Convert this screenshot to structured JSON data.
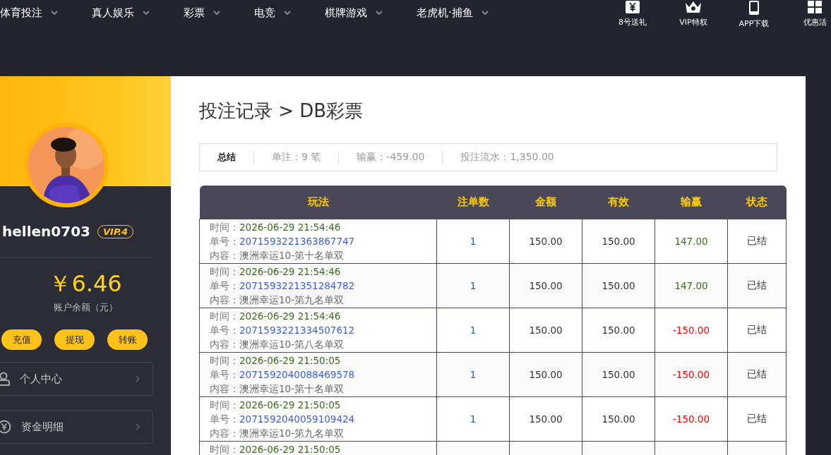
{
  "nav": {
    "items": [
      "体育投注",
      "真人娱乐",
      "彩票",
      "电竞",
      "棋牌游戏",
      "老虎机·捕鱼"
    ],
    "quick_links": [
      "8号送礼",
      "VIP特权",
      "APP下载",
      "优惠活"
    ]
  },
  "profile": {
    "avatar": {
      "kind": "picture"
    },
    "username": "hellen0703",
    "vip_badge": "VIP.4",
    "balance": "￥6.46",
    "balance_label": "账户余额（元）",
    "actions": [
      "充值",
      "提现",
      "转账"
    ],
    "menu": [
      {
        "label": "个人中心"
      },
      {
        "label": "资金明细"
      }
    ]
  },
  "page_title": "投注记录 > DB彩票",
  "summary": {
    "title": "总结",
    "items": [
      "单注：9 笔",
      "输赢：-459.00",
      "投注流水：1,350.00"
    ]
  },
  "table": {
    "columns": [
      "玩法",
      "注单数",
      "金额",
      "有效",
      "输赢",
      "状态"
    ],
    "rows": [
      {
        "time_label": "时间：",
        "time": "2026-06-29 21:54:46",
        "order_label": "单号：",
        "order": "2071593221363867747",
        "content_label": "内容：",
        "content": "澳洲幸运10-第十名单双",
        "count": "1",
        "amount": "150.00",
        "valid": "150.00",
        "loss": false,
        "win_loss": "147.00",
        "status": "已结"
      },
      {
        "time_label": "时间：",
        "time": "2026-06-29 21:54:46",
        "order_label": "单号：",
        "order": "2071593221351284782",
        "content_label": "内容：",
        "content": "澳洲幸运10-第九名单双",
        "count": "1",
        "amount": "150.00",
        "valid": "150.00",
        "loss": false,
        "win_loss": "147.00",
        "status": "已结"
      },
      {
        "time_label": "时间：",
        "time": "2026-06-29 21:54:46",
        "order_label": "单号：",
        "order": "2071593221334507612",
        "content_label": "内容：",
        "content": "澳洲幸运10-第八名单双",
        "count": "1",
        "amount": "150.00",
        "valid": "150.00",
        "loss": true,
        "win_loss": "-150.00",
        "status": "已结"
      },
      {
        "time_label": "时间：",
        "time": "2026-06-29 21:50:05",
        "order_label": "单号：",
        "order": "2071592040088469578",
        "content_label": "内容：",
        "content": "澳洲幸运10-第十名单双",
        "count": "1",
        "amount": "150.00",
        "valid": "150.00",
        "loss": true,
        "win_loss": "-150.00",
        "status": "已结"
      },
      {
        "time_label": "时间：",
        "time": "2026-06-29 21:50:05",
        "order_label": "单号：",
        "order": "2071592040059109424",
        "content_label": "内容：",
        "content": "澳洲幸运10-第九名单双",
        "count": "1",
        "amount": "150.00",
        "valid": "150.00",
        "loss": true,
        "win_loss": "-150.00",
        "status": "已结"
      },
      {
        "time_label": "时间：",
        "time": "2026-06-29 21:50:05"
      }
    ]
  }
}
